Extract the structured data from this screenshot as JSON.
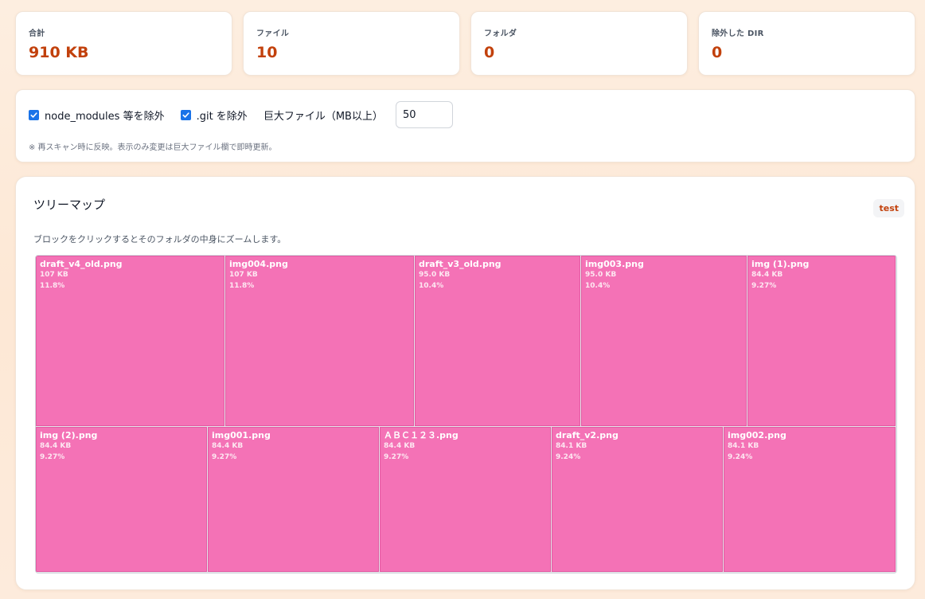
{
  "stats": [
    {
      "label": "合計",
      "value": "910 KB"
    },
    {
      "label": "ファイル",
      "value": "10"
    },
    {
      "label": "フォルダ",
      "value": "0"
    },
    {
      "label": "除外した DIR",
      "value": "0"
    }
  ],
  "options": {
    "exclude_node_modules_label": "node_modules 等を除外",
    "exclude_node_modules_checked": true,
    "exclude_git_label": ".git を除外",
    "exclude_git_checked": true,
    "large_file_label": "巨大ファイル（MB以上）",
    "large_file_value": "50",
    "note": "※ 再スキャン時に反映。表示のみ変更は巨大ファイル欄で即時更新。"
  },
  "treemap": {
    "title": "ツリーマップ",
    "badge": "test",
    "description": "ブロックをクリックするとそのフォルダの中身にズームします。",
    "block_color": "#f472b6",
    "rows": [
      {
        "share": 0.54,
        "items": [
          {
            "name": "draft_v4_old.png",
            "size": "107 KB",
            "percent": "11.8%",
            "weight": 11.8
          },
          {
            "name": "img004.png",
            "size": "107 KB",
            "percent": "11.8%",
            "weight": 11.8
          },
          {
            "name": "draft_v3_old.png",
            "size": "95.0 KB",
            "percent": "10.4%",
            "weight": 10.4
          },
          {
            "name": "img003.png",
            "size": "95.0 KB",
            "percent": "10.4%",
            "weight": 10.4
          },
          {
            "name": "img (1).png",
            "size": "84.4 KB",
            "percent": "9.27%",
            "weight": 9.27
          }
        ]
      },
      {
        "share": 0.46,
        "items": [
          {
            "name": "img (2).png",
            "size": "84.4 KB",
            "percent": "9.27%",
            "weight": 9.27
          },
          {
            "name": "img001.png",
            "size": "84.4 KB",
            "percent": "9.27%",
            "weight": 9.27
          },
          {
            "name": "ＡＢＣ１２３.png",
            "size": "84.4 KB",
            "percent": "9.27%",
            "weight": 9.27
          },
          {
            "name": "draft_v2.png",
            "size": "84.1 KB",
            "percent": "9.24%",
            "weight": 9.24
          },
          {
            "name": "img002.png",
            "size": "84.1 KB",
            "percent": "9.24%",
            "weight": 9.24
          }
        ]
      }
    ]
  }
}
